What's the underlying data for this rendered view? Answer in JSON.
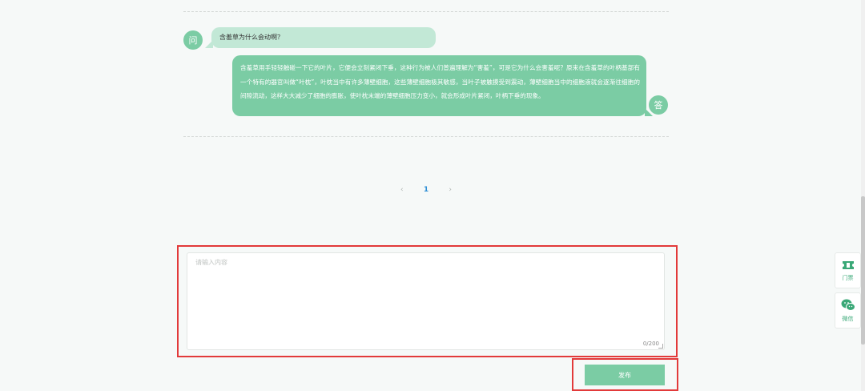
{
  "qa": {
    "question_avatar": "问",
    "question": "含羞草为什么会动啊？",
    "answer_avatar": "答",
    "answer": "含羞草用手轻轻触碰一下它的叶片，它便会立刻紧闭下垂，这种行为被人们普遍理解为“害羞”，可是它为什么会害羞呢？原来在含羞草的叶柄基部有一个特有的器官叫做“叶枕”，叶枕当中有许多薄壁细胞，这些薄壁细胞极其敏感，当叶子被触摸受到震动，薄壁细胞当中的细胞液就会逐渐往细胞的间隙流动，这样大大减少了细胞的膨胀，使叶枕末端的薄壁细胞压力变小，就会形成叶片紧闭，叶柄下垂的现象。"
  },
  "pagination": {
    "prev": "‹",
    "current": "1",
    "next": "›"
  },
  "comment": {
    "placeholder": "请输入内容",
    "counter": "0/200",
    "submit_label": "发布"
  },
  "side_tools": {
    "ticket_label": "门票",
    "ticket_icon": "ticket-icon",
    "wechat_label": "微信",
    "wechat_icon": "wechat-icon"
  },
  "colors": {
    "accent": "#7bcca4",
    "question_bg": "#c2e8d6",
    "highlight": "#e23a3a",
    "page_active": "#2f8fd6"
  }
}
